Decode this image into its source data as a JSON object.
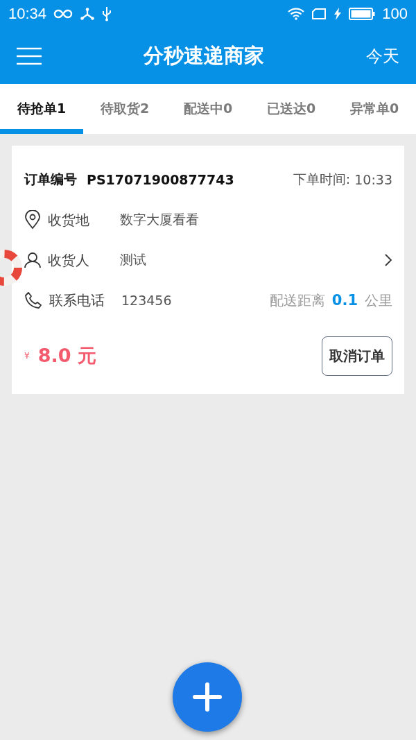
{
  "status_bar": {
    "time": "10:34",
    "battery": "100"
  },
  "app_bar": {
    "title": "分秒速递商家",
    "action": "今天"
  },
  "tabs": [
    {
      "label": "待抢单1",
      "selected": true
    },
    {
      "label": "待取货2",
      "selected": false
    },
    {
      "label": "配送中0",
      "selected": false
    },
    {
      "label": "已送达0",
      "selected": false
    },
    {
      "label": "异常单0",
      "selected": false
    }
  ],
  "orders": [
    {
      "order_label": "订单编号",
      "order_no": "PS17071900877743",
      "time_label": "下单时间:",
      "time": "10:33",
      "rows": [
        {
          "kind": "address",
          "label": "收货地",
          "value": "数字大厦看看"
        },
        {
          "kind": "person",
          "label": "收货人",
          "value": "测试",
          "chevron": true
        },
        {
          "kind": "phone",
          "label": "联系电话",
          "value": "123456",
          "distance_label": "配送距离",
          "distance": "0.1",
          "distance_unit": "公里"
        }
      ],
      "currency": "¥",
      "price": "8.0 元",
      "cancel": "取消订单"
    }
  ]
}
